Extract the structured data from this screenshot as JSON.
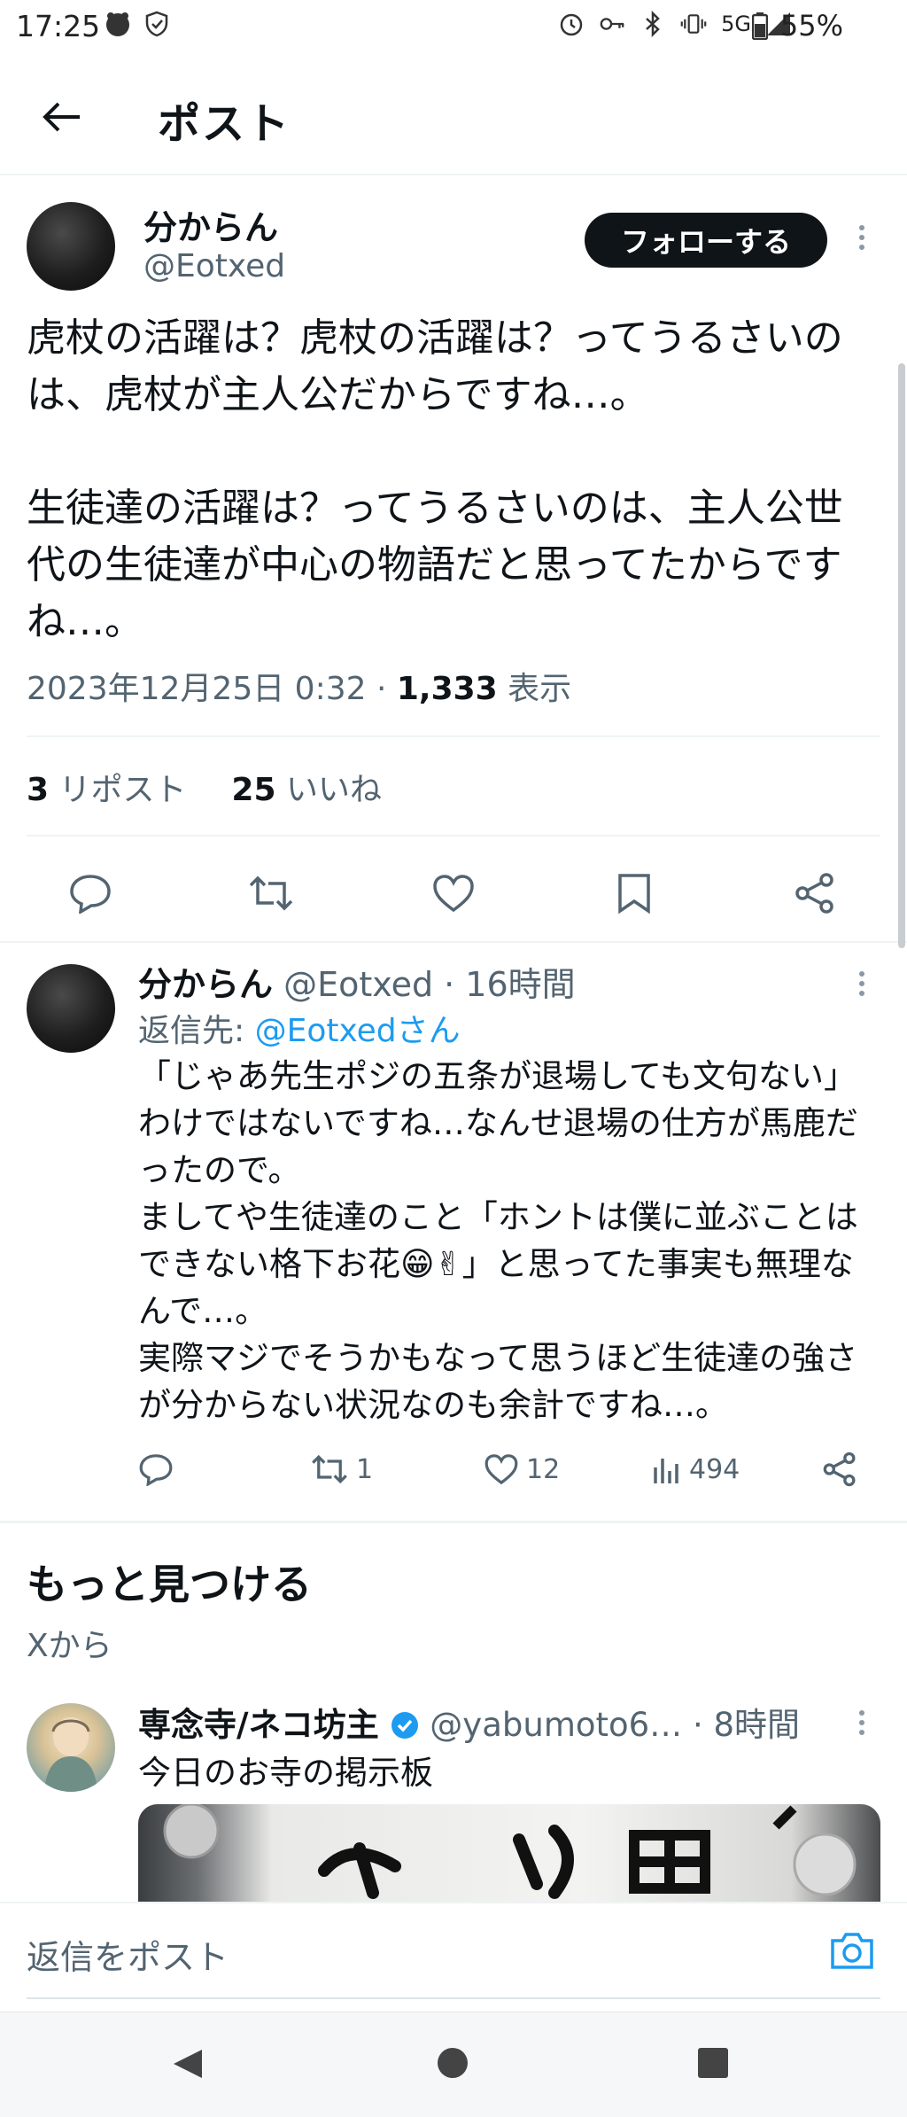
{
  "status_bar": {
    "time": "17:25",
    "network": "5G",
    "battery": "55%"
  },
  "header": {
    "title": "ポスト"
  },
  "post": {
    "author_name": "分からん",
    "author_handle": "@Eotxed",
    "follow_label": "フォローする",
    "text": "虎杖の活躍は？虎杖の活躍は？ってうるさいのは、虎杖が主人公だからですね…。\n\n生徒達の活躍は？ってうるさいのは、主人公世代の生徒達が中心の物語だと思ってたからですね…。",
    "timestamp": "2023年12月25日 0:32 · ",
    "views_count": "1,333",
    "views_label": " 表示",
    "reposts_count": "3",
    "reposts_label": " リポスト",
    "likes_count": "25",
    "likes_label": " いいね"
  },
  "reply": {
    "author_name": "分からん",
    "author_meta": " @Eotxed · 16時間",
    "reply_to_label": "返信先: ",
    "reply_to_handle": "@Eotxedさん",
    "text": "「じゃあ先生ポジの五条が退場しても文句ない」わけではないですね…なんせ退場の仕方が馬鹿だったので。\nましてや生徒達のこと「ホントは僕に並ぶことはできない格下お花😁✌」と思ってた事実も無理なんで…。\n実際マジでそうかもなって思うほど生徒達の強さが分からない状況なのも余計ですね…。",
    "reposts": "1",
    "likes": "12",
    "views": "494"
  },
  "discover": {
    "title": "もっと見つける",
    "subtitle": "Xから",
    "item": {
      "author_name": "専念寺/ネコ坊主",
      "author_meta": " @yabumoto6… · 8時間",
      "text": "今日のお寺の掲示板"
    }
  },
  "composer": {
    "placeholder": "返信をポスト"
  },
  "colors": {
    "accent": "#1d9bf0",
    "text": "#0f1419",
    "muted": "#536471",
    "divider": "#eff3f4"
  }
}
